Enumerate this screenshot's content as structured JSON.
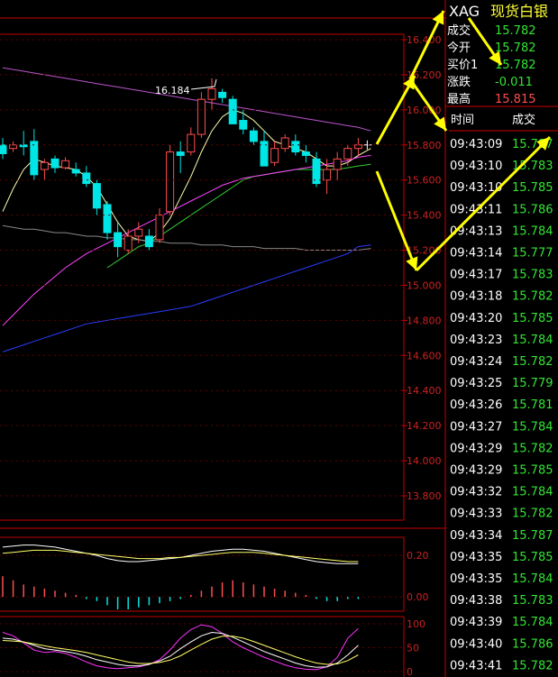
{
  "symbol": "XAG",
  "name": "现货白银",
  "quote": [
    {
      "label": "成交",
      "value": "15.782",
      "color": "#33e633"
    },
    {
      "label": "今开",
      "value": "15.782",
      "color": "#33e633"
    },
    {
      "label": "买价1",
      "value": "15.782",
      "color": "#33e633"
    },
    {
      "label": "涨跌",
      "value": "-0.011",
      "color": "#33e633"
    },
    {
      "label": "最高",
      "value": "15.815",
      "color": "#ff4d4d"
    }
  ],
  "ticks_header": {
    "time": "时间",
    "price": "成交"
  },
  "ticks": [
    {
      "time": "09:43:09",
      "price": "15.787"
    },
    {
      "time": "09:43:10",
      "price": "15.783"
    },
    {
      "time": "09:43:10",
      "price": "15.785"
    },
    {
      "time": "09:43:11",
      "price": "15.786"
    },
    {
      "time": "09:43:13",
      "price": "15.784"
    },
    {
      "time": "09:43:14",
      "price": "15.777"
    },
    {
      "time": "09:43:17",
      "price": "15.783"
    },
    {
      "time": "09:43:18",
      "price": "15.782"
    },
    {
      "time": "09:43:20",
      "price": "15.785"
    },
    {
      "time": "09:43:23",
      "price": "15.784"
    },
    {
      "time": "09:43:24",
      "price": "15.782"
    },
    {
      "time": "09:43:25",
      "price": "15.779"
    },
    {
      "time": "09:43:26",
      "price": "15.781"
    },
    {
      "time": "09:43:27",
      "price": "15.784"
    },
    {
      "time": "09:43:29",
      "price": "15.782"
    },
    {
      "time": "09:43:29",
      "price": "15.785"
    },
    {
      "time": "09:43:32",
      "price": "15.784"
    },
    {
      "time": "09:43:33",
      "price": "15.782"
    },
    {
      "time": "09:43:34",
      "price": "15.787"
    },
    {
      "time": "09:43:35",
      "price": "15.785"
    },
    {
      "time": "09:43:35",
      "price": "15.784"
    },
    {
      "time": "09:43:38",
      "price": "15.783"
    },
    {
      "time": "09:43:39",
      "price": "15.784"
    },
    {
      "time": "09:43:40",
      "price": "15.786"
    },
    {
      "time": "09:43:41",
      "price": "15.782"
    }
  ],
  "colors": {
    "up": "#ff4d4d",
    "down": "#00e5e5",
    "arrow": "#ffff00",
    "grid": "#c00000"
  },
  "chart_data": [
    {
      "type": "candlestick",
      "ylim": [
        13.8,
        16.5
      ],
      "yticks": [
        "16.400",
        "16.200",
        "16.000",
        "15.800",
        "15.600",
        "15.400",
        "15.200",
        "15.000",
        "14.800",
        "14.600",
        "14.400",
        "14.200",
        "14.000",
        "13.800"
      ],
      "annotations": [
        {
          "text": "16.184",
          "value": 16.184
        }
      ],
      "candles": [
        {
          "o": 15.8,
          "h": 15.84,
          "l": 15.72,
          "c": 15.75
        },
        {
          "o": 15.78,
          "h": 15.82,
          "l": 15.76,
          "c": 15.8
        },
        {
          "o": 15.8,
          "h": 15.88,
          "l": 15.74,
          "c": 15.79
        },
        {
          "o": 15.82,
          "h": 15.89,
          "l": 15.6,
          "c": 15.63
        },
        {
          "o": 15.66,
          "h": 15.72,
          "l": 15.6,
          "c": 15.7
        },
        {
          "o": 15.72,
          "h": 15.74,
          "l": 15.64,
          "c": 15.67
        },
        {
          "o": 15.67,
          "h": 15.73,
          "l": 15.66,
          "c": 15.71
        },
        {
          "o": 15.66,
          "h": 15.7,
          "l": 15.62,
          "c": 15.64
        },
        {
          "o": 15.64,
          "h": 15.68,
          "l": 15.56,
          "c": 15.58
        },
        {
          "o": 15.58,
          "h": 15.6,
          "l": 15.4,
          "c": 15.44
        },
        {
          "o": 15.46,
          "h": 15.48,
          "l": 15.26,
          "c": 15.3
        },
        {
          "o": 15.3,
          "h": 15.36,
          "l": 15.16,
          "c": 15.22
        },
        {
          "o": 15.2,
          "h": 15.32,
          "l": 15.18,
          "c": 15.28
        },
        {
          "o": 15.28,
          "h": 15.36,
          "l": 15.24,
          "c": 15.32
        },
        {
          "o": 15.28,
          "h": 15.32,
          "l": 15.2,
          "c": 15.22
        },
        {
          "o": 15.26,
          "h": 15.44,
          "l": 15.24,
          "c": 15.4
        },
        {
          "o": 15.42,
          "h": 15.8,
          "l": 15.4,
          "c": 15.76
        },
        {
          "o": 15.76,
          "h": 15.82,
          "l": 15.64,
          "c": 15.74
        },
        {
          "o": 15.76,
          "h": 15.9,
          "l": 15.74,
          "c": 15.86
        },
        {
          "o": 15.86,
          "h": 16.1,
          "l": 15.84,
          "c": 16.06
        },
        {
          "o": 16.06,
          "h": 16.18,
          "l": 16.0,
          "c": 16.12
        },
        {
          "o": 16.1,
          "h": 16.12,
          "l": 16.04,
          "c": 16.07
        },
        {
          "o": 16.06,
          "h": 16.08,
          "l": 15.92,
          "c": 15.92
        },
        {
          "o": 15.94,
          "h": 16.0,
          "l": 15.86,
          "c": 15.89
        },
        {
          "o": 15.88,
          "h": 15.9,
          "l": 15.8,
          "c": 15.82
        },
        {
          "o": 15.82,
          "h": 15.88,
          "l": 15.68,
          "c": 15.68
        },
        {
          "o": 15.7,
          "h": 15.82,
          "l": 15.68,
          "c": 15.78
        },
        {
          "o": 15.78,
          "h": 15.86,
          "l": 15.76,
          "c": 15.84
        },
        {
          "o": 15.82,
          "h": 15.86,
          "l": 15.74,
          "c": 15.76
        },
        {
          "o": 15.76,
          "h": 15.8,
          "l": 15.7,
          "c": 15.74
        },
        {
          "o": 15.72,
          "h": 15.76,
          "l": 15.56,
          "c": 15.58
        },
        {
          "o": 15.6,
          "h": 15.72,
          "l": 15.52,
          "c": 15.66
        },
        {
          "o": 15.66,
          "h": 15.76,
          "l": 15.6,
          "c": 15.72
        },
        {
          "o": 15.72,
          "h": 15.8,
          "l": 15.68,
          "c": 15.78
        },
        {
          "o": 15.78,
          "h": 15.84,
          "l": 15.74,
          "c": 15.8
        }
      ],
      "ma_lines": [
        {
          "color": "#ffffb0",
          "values": [
            15.42,
            15.55,
            15.66,
            15.72,
            15.7,
            15.68,
            15.67,
            15.66,
            15.62,
            15.56,
            15.46,
            15.36,
            15.28,
            15.26,
            15.25,
            15.3,
            15.38,
            15.5,
            15.62,
            15.76,
            15.88,
            15.96,
            16.0,
            15.98,
            15.94,
            15.88,
            15.82,
            15.8,
            15.78,
            15.76,
            15.72,
            15.68,
            15.68,
            15.7,
            15.74
          ]
        },
        {
          "color": "#33cc33",
          "values": [
            null,
            null,
            null,
            null,
            null,
            null,
            null,
            null,
            null,
            null,
            15.1,
            15.14,
            15.18,
            15.22,
            15.24,
            15.28,
            15.32,
            15.36,
            15.4,
            15.44,
            15.48,
            15.52,
            15.56,
            15.6,
            15.62,
            15.63,
            15.64,
            15.65,
            15.66,
            15.66,
            15.66,
            15.66,
            15.66,
            15.67,
            15.68
          ]
        },
        {
          "color": "#ff44ff",
          "values": [
            14.77,
            14.83,
            14.89,
            14.95,
            15.0,
            15.05,
            15.1,
            15.14,
            15.18,
            15.21,
            15.24,
            15.27,
            15.3,
            15.33,
            15.36,
            15.39,
            15.42,
            15.45,
            15.48,
            15.51,
            15.54,
            15.57,
            15.59,
            15.61,
            15.62,
            15.63,
            15.64,
            15.65,
            15.66,
            15.67,
            15.68,
            15.69,
            15.7,
            15.71,
            15.73
          ]
        },
        {
          "color": "#2a3cff",
          "values": [
            14.62,
            14.64,
            14.66,
            14.68,
            14.7,
            14.72,
            14.74,
            14.76,
            14.78,
            14.79,
            14.8,
            14.81,
            14.82,
            14.83,
            14.84,
            14.85,
            14.86,
            14.87,
            14.88,
            14.9,
            14.92,
            14.94,
            14.96,
            14.98,
            15.0,
            15.02,
            15.04,
            15.06,
            15.08,
            15.1,
            15.12,
            15.14,
            15.16,
            15.18,
            15.22
          ]
        },
        {
          "color": "#bb55cc",
          "values": [
            16.24,
            16.23,
            16.22,
            16.21,
            16.2,
            16.19,
            16.18,
            16.17,
            16.16,
            16.15,
            16.14,
            16.13,
            16.12,
            16.11,
            16.1,
            16.09,
            16.08,
            16.07,
            16.06,
            16.05,
            16.04,
            16.03,
            16.02,
            16.01,
            16.0,
            15.99,
            15.98,
            15.97,
            15.96,
            15.95,
            15.94,
            15.93,
            15.92,
            15.91,
            15.9
          ]
        },
        {
          "color": "#888888",
          "values": [
            15.34,
            15.33,
            15.32,
            15.32,
            15.31,
            15.3,
            15.3,
            15.29,
            15.28,
            15.28,
            15.27,
            15.27,
            15.26,
            15.26,
            15.25,
            15.25,
            15.24,
            15.24,
            15.24,
            15.23,
            15.23,
            15.23,
            15.22,
            15.22,
            15.22,
            15.21,
            15.21,
            15.21,
            15.21,
            15.2,
            15.2,
            15.2,
            15.2,
            15.2,
            15.2
          ]
        }
      ]
    },
    {
      "type": "bar",
      "yticks": [
        "0.20",
        "0.00"
      ],
      "ylim": [
        -0.06,
        0.27
      ],
      "values": [
        0.1,
        0.08,
        0.06,
        0.05,
        0.04,
        0.03,
        0.02,
        0.01,
        -0.01,
        -0.02,
        -0.04,
        -0.06,
        -0.06,
        -0.05,
        -0.04,
        -0.03,
        -0.02,
        -0.01,
        0.01,
        0.03,
        0.05,
        0.07,
        0.08,
        0.07,
        0.06,
        0.05,
        0.04,
        0.03,
        0.02,
        0.01,
        -0.01,
        -0.02,
        -0.02,
        -0.01,
        -0.01
      ],
      "lines": [
        {
          "color": "#ffffff",
          "values": [
            0.24,
            0.245,
            0.25,
            0.25,
            0.245,
            0.24,
            0.23,
            0.22,
            0.21,
            0.2,
            0.185,
            0.175,
            0.17,
            0.17,
            0.175,
            0.18,
            0.185,
            0.19,
            0.2,
            0.21,
            0.22,
            0.225,
            0.23,
            0.23,
            0.225,
            0.22,
            0.21,
            0.2,
            0.19,
            0.18,
            0.17,
            0.165,
            0.16,
            0.16,
            0.16
          ]
        },
        {
          "color": "#ffff66",
          "values": [
            0.21,
            0.215,
            0.22,
            0.225,
            0.225,
            0.225,
            0.22,
            0.215,
            0.21,
            0.205,
            0.2,
            0.195,
            0.19,
            0.185,
            0.185,
            0.185,
            0.19,
            0.19,
            0.195,
            0.2,
            0.205,
            0.21,
            0.215,
            0.215,
            0.215,
            0.21,
            0.205,
            0.2,
            0.195,
            0.19,
            0.185,
            0.18,
            0.175,
            0.17,
            0.17
          ]
        }
      ]
    },
    {
      "type": "line",
      "yticks": [
        "100",
        "50",
        "0"
      ],
      "ylim": [
        0,
        100
      ],
      "series": [
        {
          "color": "#ff33ff",
          "values": [
            82,
            75,
            60,
            45,
            40,
            42,
            38,
            30,
            20,
            12,
            8,
            6,
            8,
            10,
            15,
            25,
            45,
            70,
            88,
            98,
            94,
            80,
            62,
            50,
            40,
            30,
            22,
            14,
            8,
            5,
            4,
            10,
            30,
            70,
            90
          ]
        },
        {
          "color": "#ffffff",
          "values": [
            70,
            68,
            62,
            55,
            48,
            45,
            42,
            38,
            32,
            25,
            20,
            15,
            12,
            12,
            15,
            22,
            32,
            48,
            62,
            75,
            82,
            80,
            72,
            62,
            52,
            42,
            34,
            26,
            18,
            12,
            9,
            10,
            18,
            35,
            55
          ]
        },
        {
          "color": "#ffff66",
          "values": [
            65,
            64,
            62,
            58,
            54,
            50,
            47,
            44,
            40,
            35,
            30,
            25,
            20,
            17,
            17,
            19,
            24,
            33,
            45,
            57,
            68,
            74,
            74,
            70,
            63,
            55,
            47,
            39,
            31,
            24,
            18,
            15,
            16,
            23,
            35
          ]
        }
      ]
    }
  ]
}
